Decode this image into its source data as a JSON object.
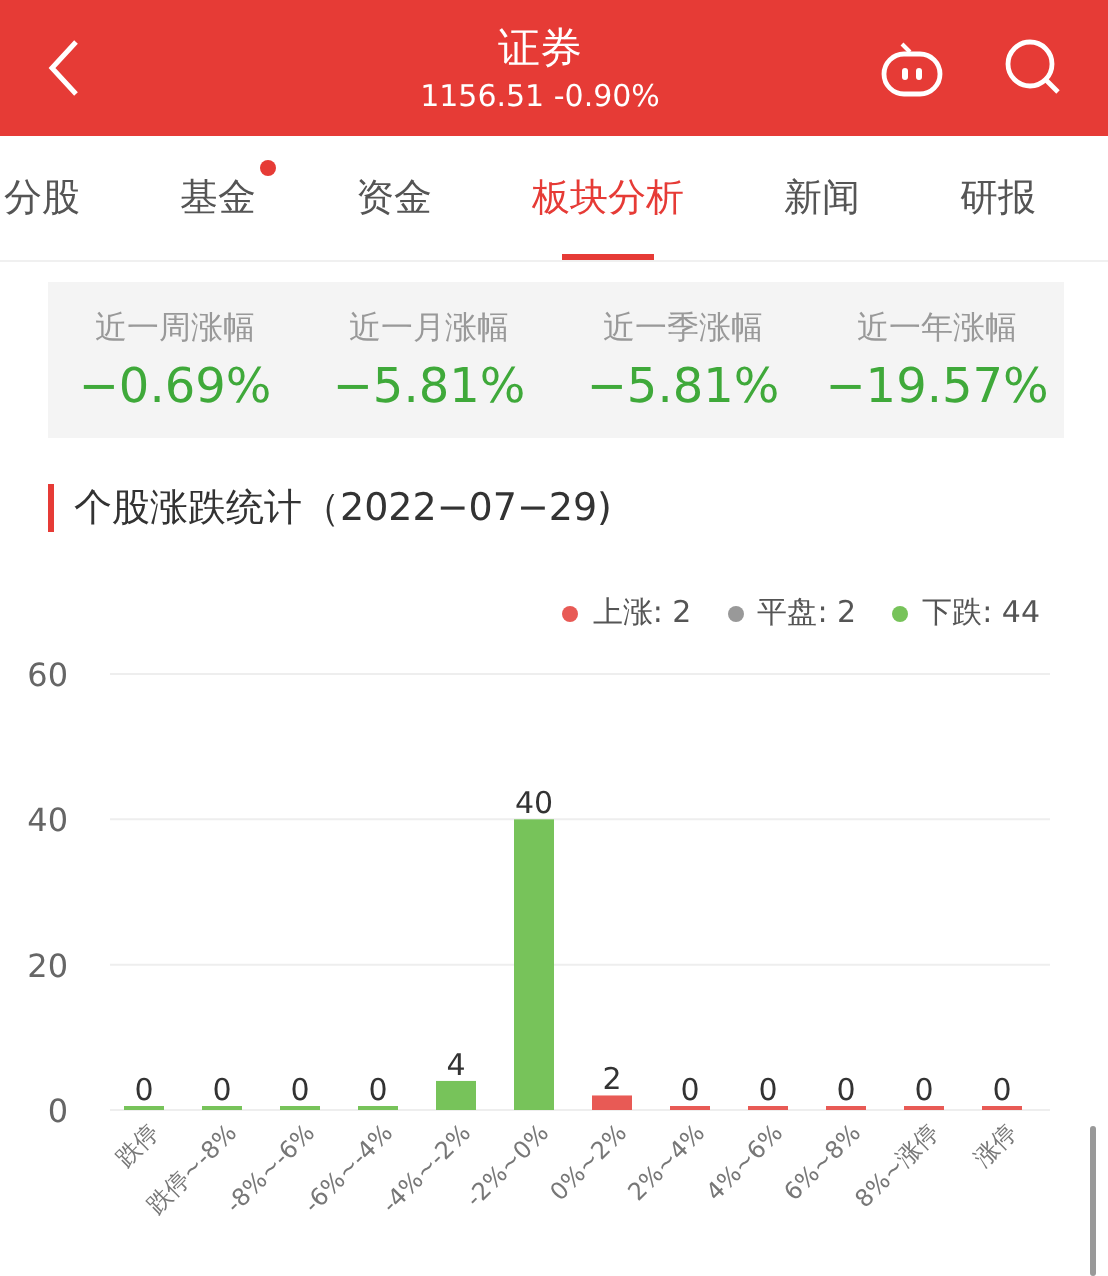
{
  "header": {
    "title": "证券",
    "subtitle": "1156.51 -0.90%"
  },
  "tabs": [
    {
      "label": "分股",
      "selected": false,
      "dot": false
    },
    {
      "label": "基金",
      "selected": false,
      "dot": true
    },
    {
      "label": "资金",
      "selected": false,
      "dot": false
    },
    {
      "label": "板块分析",
      "selected": true,
      "dot": false
    },
    {
      "label": "新闻",
      "selected": false,
      "dot": false
    },
    {
      "label": "研报",
      "selected": false,
      "dot": false
    }
  ],
  "stats": [
    {
      "label": "近一周涨幅",
      "value": "−0.69%"
    },
    {
      "label": "近一月涨幅",
      "value": "−5.81%"
    },
    {
      "label": "近一季涨幅",
      "value": "−5.81%"
    },
    {
      "label": "近一年涨幅",
      "value": "−19.57%"
    }
  ],
  "section_title": "个股涨跌统计（2022−07−29)",
  "legend": [
    {
      "label": "上涨: 2",
      "color": "#e85a55"
    },
    {
      "label": "平盘: 2",
      "color": "#999999"
    },
    {
      "label": "下跌: 44",
      "color": "#77c35a"
    }
  ],
  "chart_data": {
    "type": "bar",
    "categories": [
      "跌停",
      "跌停~-8%",
      "-8%~-6%",
      "-6%~-4%",
      "-4%~-2%",
      "-2%~0%",
      "0%~2%",
      "2%~4%",
      "4%~6%",
      "6%~8%",
      "8%~涨停",
      "涨停"
    ],
    "series": [
      {
        "color": "#77c35a",
        "values": [
          0,
          0,
          0,
          0,
          4,
          40,
          null,
          null,
          null,
          null,
          null,
          null
        ]
      },
      {
        "color": "#e85a55",
        "values": [
          null,
          null,
          null,
          null,
          null,
          null,
          2,
          0,
          0,
          0,
          0,
          0
        ]
      }
    ],
    "ylim": [
      0,
      60
    ],
    "yticks": [
      0,
      20,
      40,
      60
    ],
    "data_labels": true
  }
}
